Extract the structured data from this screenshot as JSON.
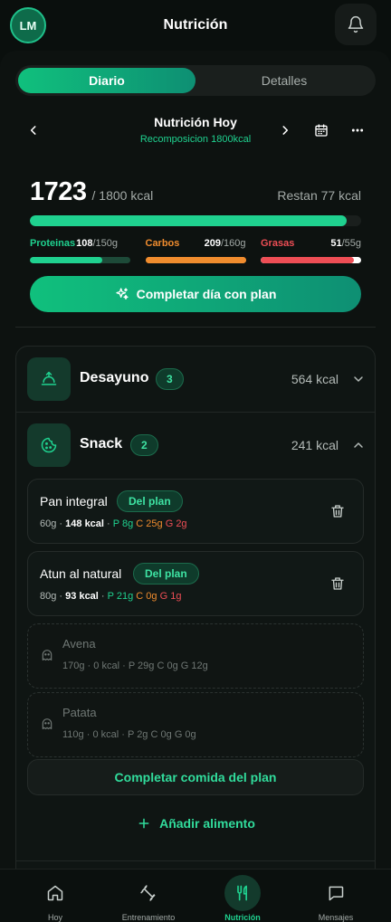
{
  "header": {
    "avatar_initials": "LM",
    "title": "Nutrición",
    "icons": {
      "notifications": "bell-icon"
    }
  },
  "tabs": [
    {
      "label": "Diario",
      "active": true
    },
    {
      "label": "Detalles",
      "active": false
    }
  ],
  "day_nav": {
    "title": "Nutrición Hoy",
    "subtitle": "Recomposicion 1800kcal",
    "icons": [
      "chevron-left-icon",
      "chevron-right-icon",
      "calendar-icon",
      "more-icon"
    ]
  },
  "summary": {
    "kcal_consumed": "1723",
    "kcal_goal_text": "/ 1800 kcal",
    "kcal_remaining_text": "Restan 77 kcal",
    "kcal_progress": 0.957,
    "macros": [
      {
        "name": "Proteinas",
        "value": "108",
        "goal": "/150g",
        "progress": 0.72,
        "color": "#1fd18f",
        "track": "#1d4a38"
      },
      {
        "name": "Carbos",
        "value": "209",
        "goal": "/160g",
        "progress": 1.0,
        "color": "#f08c2e",
        "track": "#f08c2e"
      },
      {
        "name": "Grasas",
        "value": "51",
        "goal": "/55g",
        "progress": 0.93,
        "color": "#ee4e55",
        "track": "#ffffff"
      }
    ]
  },
  "complete_day_button": {
    "label": "Completar día con plan",
    "icon": "sparkle-icon"
  },
  "meals": [
    {
      "name": "Desayuno",
      "count": "3",
      "kcal": "564 kcal",
      "expanded": false,
      "icon": "breakfast-icon"
    },
    {
      "name": "Snack",
      "count": "2",
      "kcal": "241 kcal",
      "expanded": true,
      "icon": "cookie-icon",
      "foods": [
        {
          "name": "Pan integral",
          "badge": "Del plan",
          "grams": "60g",
          "kcal": "148 kcal",
          "p": "P 8g",
          "c": "C 25g",
          "g": "G 2g",
          "ghost": false
        },
        {
          "name": "Atun al natural",
          "badge": "Del plan",
          "grams": "80g",
          "kcal": "93 kcal",
          "p": "P 21g",
          "c": "C 0g",
          "g": "G 1g",
          "ghost": false
        },
        {
          "name": "Avena",
          "badge": "",
          "grams": "170g",
          "kcal": "0 kcal",
          "p": "P 29g",
          "c": "C 0g",
          "g": "G 12g",
          "ghost": true
        },
        {
          "name": "Patata",
          "badge": "",
          "grams": "110g",
          "kcal": "0 kcal",
          "p": "P 2g",
          "c": "C 0g",
          "g": "G 0g",
          "ghost": true
        }
      ],
      "complete_meal_label": "Completar comida del plan",
      "add_food_label": "Añadir alimento"
    }
  ],
  "separator": "·",
  "bottom_nav": [
    {
      "label": "Hoy",
      "icon": "home-icon",
      "active": false
    },
    {
      "label": "Entrenamiento",
      "icon": "dumbbell-icon",
      "active": false
    },
    {
      "label": "Nutrición",
      "icon": "fork-knife-icon",
      "active": true
    },
    {
      "label": "Mensajes",
      "icon": "chat-icon",
      "active": false
    }
  ]
}
